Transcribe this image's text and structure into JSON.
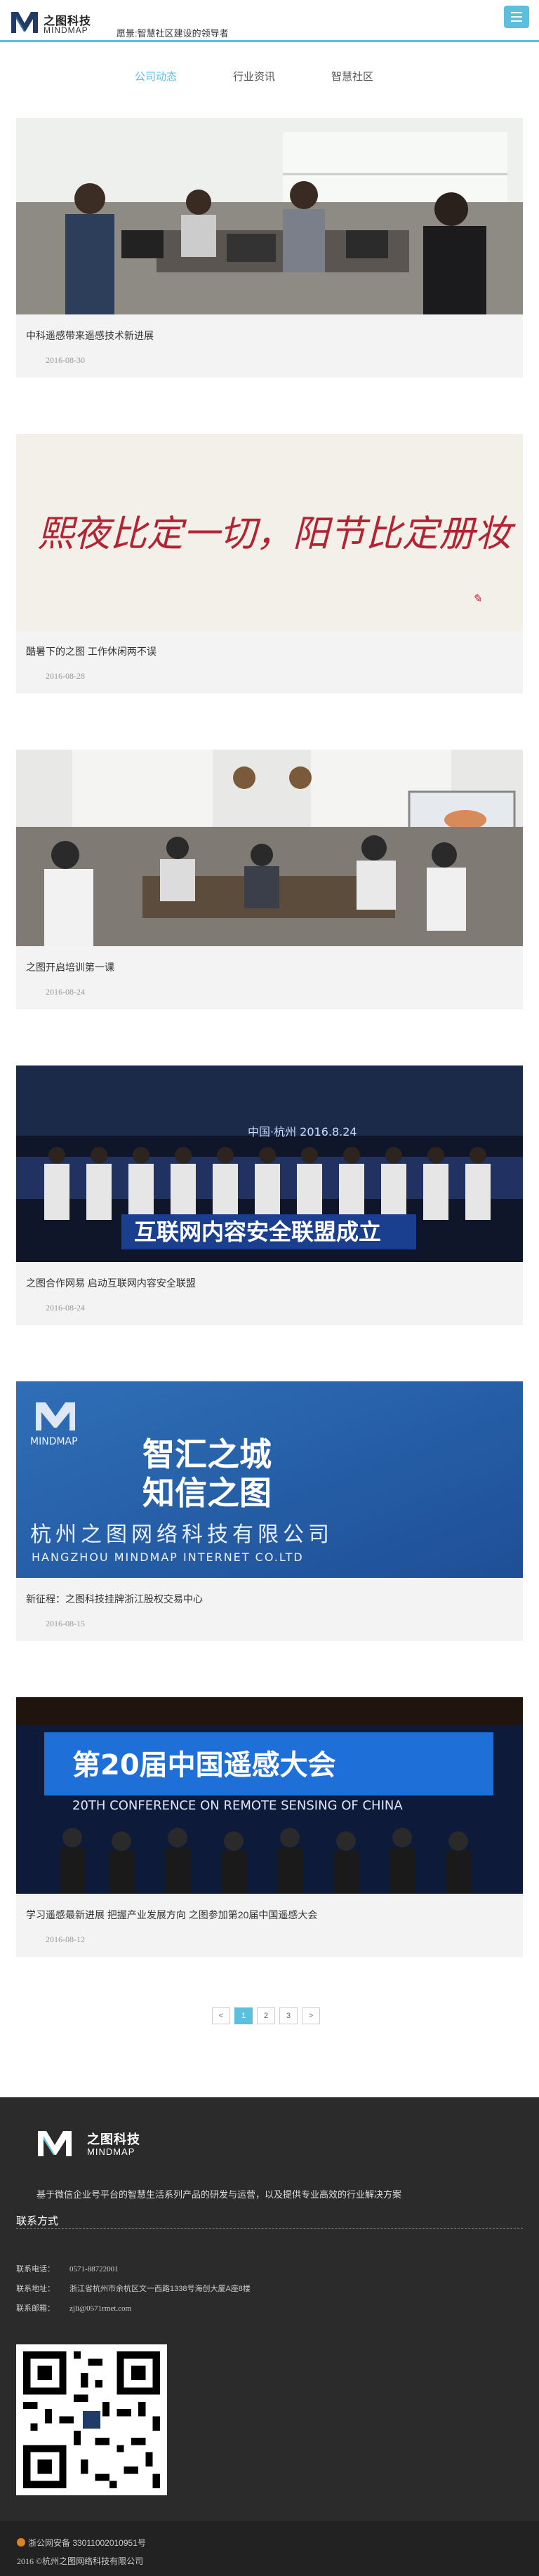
{
  "header": {
    "logo_cn": "之图科技",
    "logo_en": "MINDMAP",
    "slogan": "愿景:智慧社区建设的领导者"
  },
  "tabs": [
    {
      "label": "公司动态",
      "active": true
    },
    {
      "label": "行业资讯",
      "active": false
    },
    {
      "label": "智慧社区",
      "active": false
    }
  ],
  "articles": [
    {
      "title": "中科遥感带来遥感技术新进展",
      "date": "2016-08-30"
    },
    {
      "title": "酷暑下的之图 工作休闲两不误",
      "date": "2016-08-28"
    },
    {
      "title": "之图开启培训第一课",
      "date": "2016-08-24"
    },
    {
      "title": "之图合作网易 启动互联网内容安全联盟",
      "date": "2016-08-24"
    },
    {
      "title": "新征程：之图科技挂牌浙江股权交易中心",
      "date": "2016-08-15"
    },
    {
      "title": "学习遥感最新进展 把握产业发展方向 之图参加第20届中国遥感大会",
      "date": "2016-08-12"
    }
  ],
  "images": {
    "calligraphy": "熙夜比定一切，阳节比定册妆",
    "banner_event2016": "中国·杭州   2016.8.24",
    "banner_alliance": "互联网内容安全联盟成立",
    "brand_logo_text": "MINDMAP",
    "brand_line1": "智汇之城",
    "brand_line2": "知信之图",
    "brand_company": "杭州之图网络科技有限公司",
    "brand_company_en": "HANGZHOU MINDMAP INTERNET CO.LTD",
    "conf_cn": "第20届中国遥感大会",
    "conf_en": "20TH CONFERENCE ON REMOTE SENSING OF CHINA"
  },
  "pagination": {
    "prev": "<",
    "pages": [
      "1",
      "2",
      "3"
    ],
    "next": ">",
    "current": "1"
  },
  "footer": {
    "logo_cn": "之图科技",
    "logo_en": "MINDMAP",
    "description": "基于微信企业号平台的智慧生活系列产品的研发与运营，以及提供专业高效的行业解决方案",
    "contact_title": "联系方式",
    "phone_label": "联系电话：",
    "phone": "0571-88722001",
    "address_label": "联系地址：",
    "address": "浙江省杭州市余杭区文一西路1338号海创大厦A座8楼",
    "email_label": "联系邮箱：",
    "email": "zjli@0571rmet.com",
    "beian": "浙公网安备 33011002010951号",
    "copyright": "2016 ©杭州之图网络科技有限公司"
  },
  "colors": {
    "accent": "#5bc0de",
    "footer_bg": "#2b2b2b",
    "card_bg": "#f3f3f4"
  }
}
